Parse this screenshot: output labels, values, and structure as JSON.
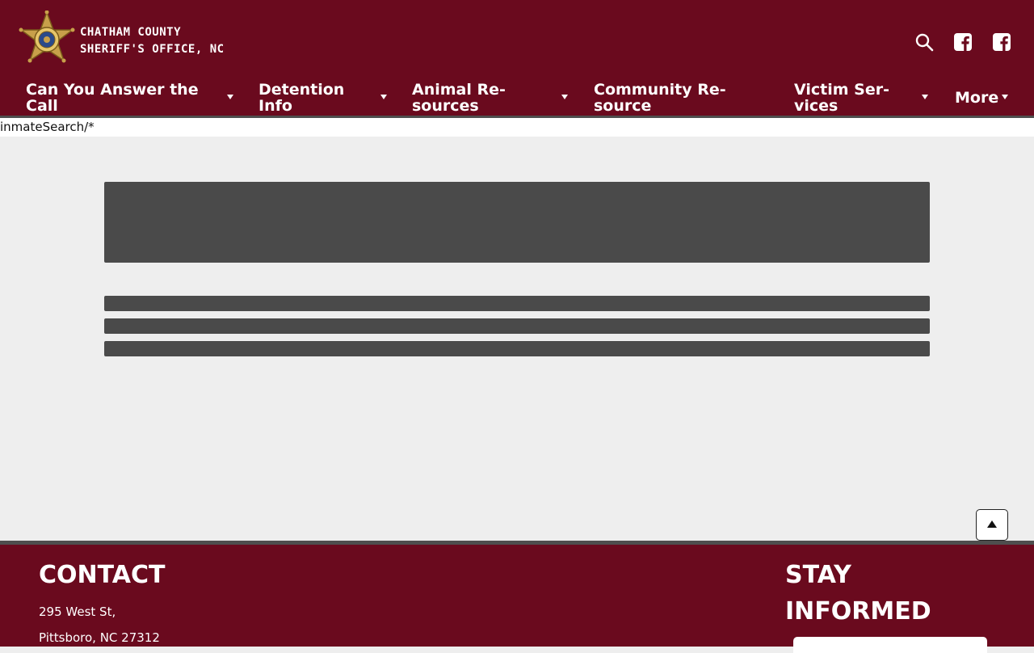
{
  "header": {
    "brand_line1": "CHATHAM COUNTY",
    "brand_line2": "SHERIFF'S OFFICE, NC",
    "logo_icon": "sheriff-star-badge",
    "icons": [
      "search-icon",
      "facebook-icon",
      "facebook-icon"
    ]
  },
  "nav": {
    "items": [
      {
        "label": "Can You Answer the Call",
        "has_dropdown": true
      },
      {
        "label": "Detention Info",
        "has_dropdown": true
      },
      {
        "label": "Animal Re- sources",
        "has_dropdown": true
      },
      {
        "label": "Community Re- source",
        "has_dropdown": false
      },
      {
        "label": "Victim Ser- vices",
        "has_dropdown": true
      },
      {
        "label": "More",
        "has_dropdown": true
      }
    ]
  },
  "path_text": "inmateSearch/*",
  "footer": {
    "contact_heading": "CONTACT",
    "address_line1": "295 West St,",
    "address_line2": "Pittsboro, NC 27312",
    "stay_heading_line1": "STAY",
    "stay_heading_line2": "INFORMED"
  },
  "colors": {
    "brand": "#6a0a1e",
    "placeholder": "#4a4a4a",
    "page_bg": "#eeeeee"
  }
}
